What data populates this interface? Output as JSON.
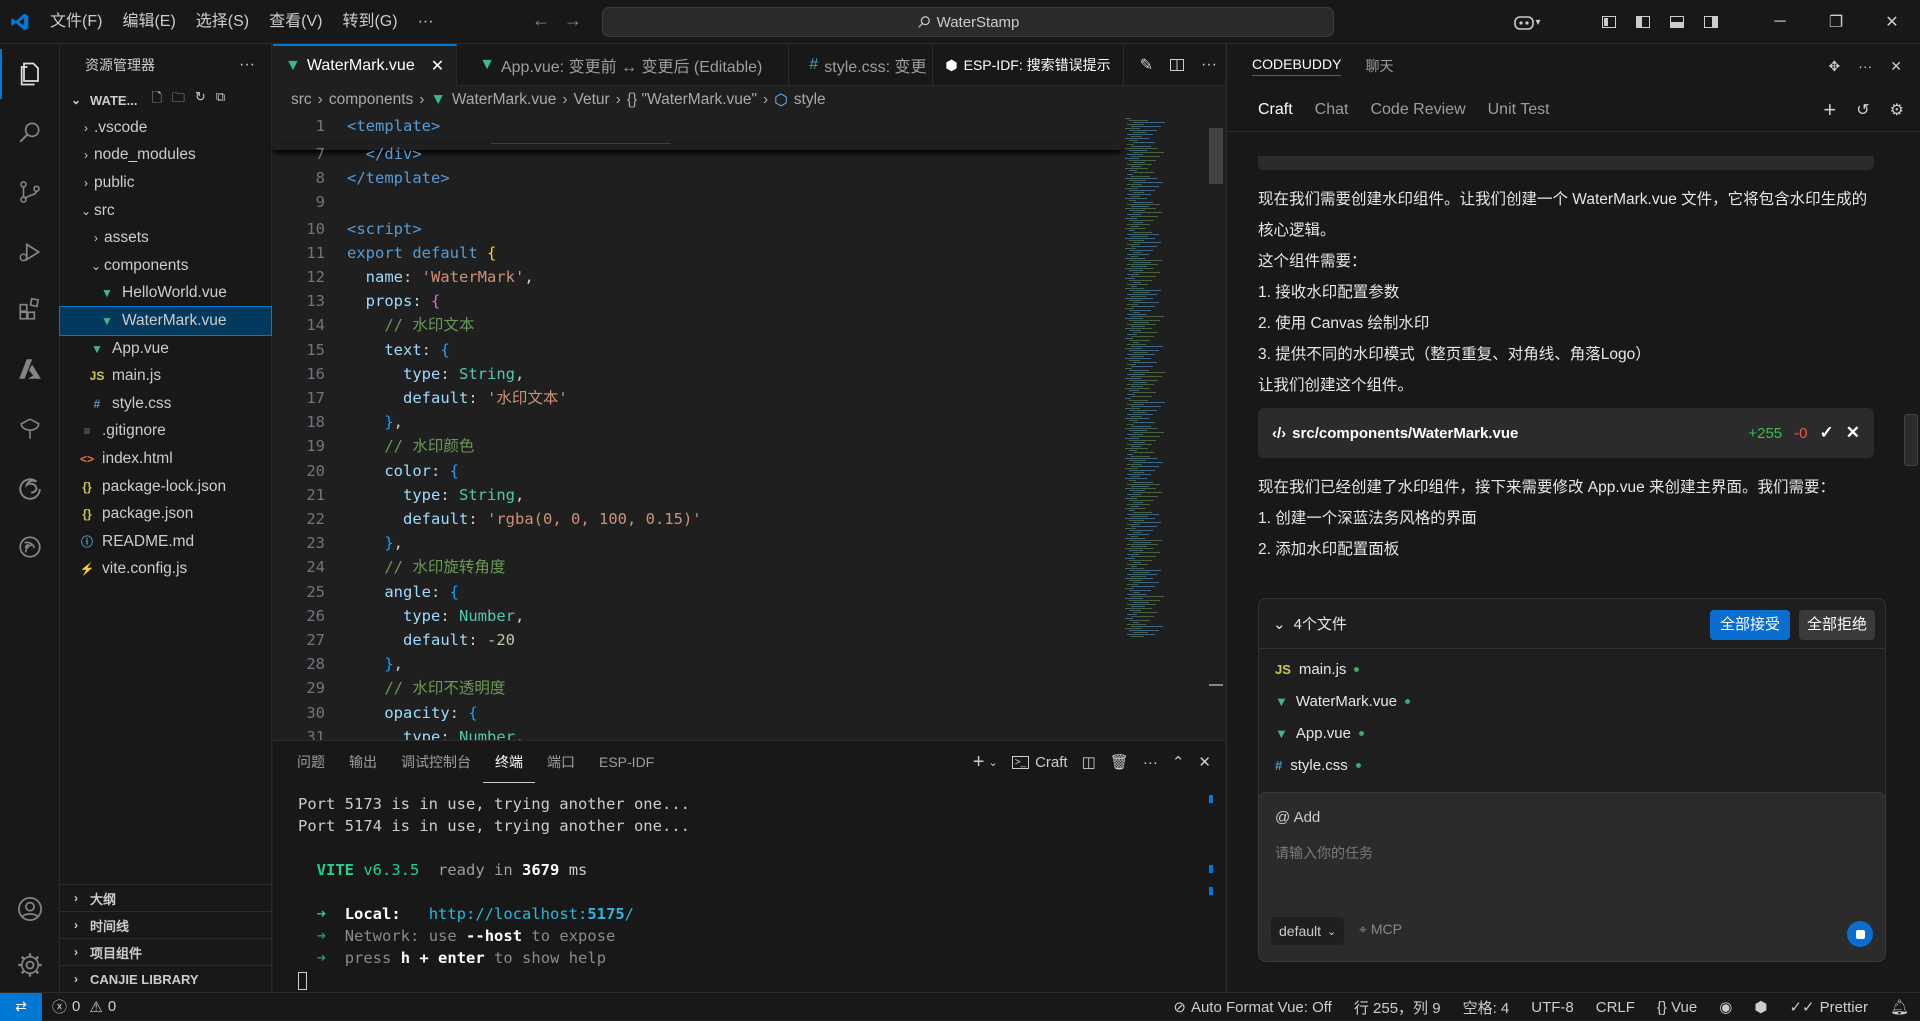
{
  "title_bar": {
    "menus": [
      "文件(F)",
      "编辑(E)",
      "选择(S)",
      "查看(V)",
      "转到(G)",
      "···"
    ],
    "search_text": "WaterStamp"
  },
  "explorer": {
    "title": "资源管理器",
    "folder": "WATE...",
    "items": [
      {
        "label": ".vscode",
        "kind": "folder",
        "indent": 1,
        "expanded": false
      },
      {
        "label": "node_modules",
        "kind": "folder",
        "indent": 1,
        "expanded": false
      },
      {
        "label": "public",
        "kind": "folder",
        "indent": 1,
        "expanded": false
      },
      {
        "label": "src",
        "kind": "folder",
        "indent": 1,
        "expanded": true
      },
      {
        "label": "assets",
        "kind": "folder",
        "indent": 2,
        "expanded": false
      },
      {
        "label": "components",
        "kind": "folder",
        "indent": 2,
        "expanded": true
      },
      {
        "label": "HelloWorld.vue",
        "kind": "vue",
        "indent": 3
      },
      {
        "label": "WaterMark.vue",
        "kind": "vue",
        "indent": 3,
        "active": true
      },
      {
        "label": "App.vue",
        "kind": "vue",
        "indent": 2
      },
      {
        "label": "main.js",
        "kind": "js",
        "indent": 2
      },
      {
        "label": "style.css",
        "kind": "css",
        "indent": 2
      },
      {
        "label": ".gitignore",
        "kind": "git",
        "indent": 1
      },
      {
        "label": "index.html",
        "kind": "html",
        "indent": 1
      },
      {
        "label": "package-lock.json",
        "kind": "json",
        "indent": 1
      },
      {
        "label": "package.json",
        "kind": "json",
        "indent": 1
      },
      {
        "label": "README.md",
        "kind": "info",
        "indent": 1
      },
      {
        "label": "vite.config.js",
        "kind": "vite",
        "indent": 1
      }
    ],
    "sections": [
      "大纲",
      "时间线",
      "项目组件",
      "CANJIE LIBRARY"
    ]
  },
  "editor": {
    "tabs": [
      {
        "label": "WaterMark.vue",
        "active": true
      },
      {
        "label": "App.vue: 变更前 ↔ 变更后 (Editable)",
        "active": false
      },
      {
        "label": "style.css: 变更",
        "active": false
      },
      {
        "label": "ESP-IDF:  搜索错误提示",
        "active": false
      }
    ],
    "breadcrumb": [
      "src",
      "components",
      "WaterMark.vue",
      "Vetur",
      "{} \"WaterMark.vue\"",
      "style"
    ],
    "code_lines": [
      {
        "n": "1",
        "tokens": [
          [
            "tag",
            "<template>"
          ]
        ]
      },
      {
        "n": "7",
        "tokens": [
          [
            "p",
            "  "
          ],
          [
            "tag",
            "</div>"
          ]
        ]
      },
      {
        "n": "8",
        "tokens": [
          [
            "tag",
            "</template>"
          ]
        ]
      },
      {
        "n": "9",
        "tokens": []
      },
      {
        "n": "10",
        "tokens": [
          [
            "tag",
            "<script>"
          ]
        ]
      },
      {
        "n": "11",
        "tokens": [
          [
            "kw",
            "export default "
          ],
          [
            "br",
            "{"
          ]
        ]
      },
      {
        "n": "12",
        "tokens": [
          [
            "p",
            "  "
          ],
          [
            "prop",
            "name"
          ],
          [
            "p",
            ": "
          ],
          [
            "str",
            "'WaterMark'"
          ],
          [
            "p",
            ","
          ]
        ]
      },
      {
        "n": "13",
        "tokens": [
          [
            "p",
            "  "
          ],
          [
            "prop",
            "props"
          ],
          [
            "p",
            ": "
          ],
          [
            "br2",
            "{"
          ]
        ]
      },
      {
        "n": "14",
        "tokens": [
          [
            "p",
            "    "
          ],
          [
            "com",
            "// 水印文本"
          ]
        ]
      },
      {
        "n": "15",
        "tokens": [
          [
            "p",
            "    "
          ],
          [
            "prop",
            "text"
          ],
          [
            "p",
            ": "
          ],
          [
            "br3",
            "{"
          ]
        ]
      },
      {
        "n": "16",
        "tokens": [
          [
            "p",
            "      "
          ],
          [
            "prop",
            "type"
          ],
          [
            "p",
            ": "
          ],
          [
            "typ",
            "String"
          ],
          [
            "p",
            ","
          ]
        ]
      },
      {
        "n": "17",
        "tokens": [
          [
            "p",
            "      "
          ],
          [
            "prop",
            "default"
          ],
          [
            "p",
            ": "
          ],
          [
            "str",
            "'水印文本'"
          ]
        ]
      },
      {
        "n": "18",
        "tokens": [
          [
            "p",
            "    "
          ],
          [
            "br3",
            "}"
          ],
          [
            "p",
            ","
          ]
        ]
      },
      {
        "n": "19",
        "tokens": [
          [
            "p",
            "    "
          ],
          [
            "com",
            "// 水印颜色"
          ]
        ]
      },
      {
        "n": "20",
        "tokens": [
          [
            "p",
            "    "
          ],
          [
            "prop",
            "color"
          ],
          [
            "p",
            ": "
          ],
          [
            "br3",
            "{"
          ]
        ]
      },
      {
        "n": "21",
        "tokens": [
          [
            "p",
            "      "
          ],
          [
            "prop",
            "type"
          ],
          [
            "p",
            ": "
          ],
          [
            "typ",
            "String"
          ],
          [
            "p",
            ","
          ]
        ]
      },
      {
        "n": "22",
        "tokens": [
          [
            "p",
            "      "
          ],
          [
            "prop",
            "default"
          ],
          [
            "p",
            ": "
          ],
          [
            "str",
            "'rgba(0, 0, 100, 0.15)'"
          ]
        ]
      },
      {
        "n": "23",
        "tokens": [
          [
            "p",
            "    "
          ],
          [
            "br3",
            "}"
          ],
          [
            "p",
            ","
          ]
        ]
      },
      {
        "n": "24",
        "tokens": [
          [
            "p",
            "    "
          ],
          [
            "com",
            "// 水印旋转角度"
          ]
        ]
      },
      {
        "n": "25",
        "tokens": [
          [
            "p",
            "    "
          ],
          [
            "prop",
            "angle"
          ],
          [
            "p",
            ": "
          ],
          [
            "br3",
            "{"
          ]
        ]
      },
      {
        "n": "26",
        "tokens": [
          [
            "p",
            "      "
          ],
          [
            "prop",
            "type"
          ],
          [
            "p",
            ": "
          ],
          [
            "typ",
            "Number"
          ],
          [
            "p",
            ","
          ]
        ]
      },
      {
        "n": "27",
        "tokens": [
          [
            "p",
            "      "
          ],
          [
            "prop",
            "default"
          ],
          [
            "p",
            ": "
          ],
          [
            "num",
            "-20"
          ]
        ]
      },
      {
        "n": "28",
        "tokens": [
          [
            "p",
            "    "
          ],
          [
            "br3",
            "}"
          ],
          [
            "p",
            ","
          ]
        ]
      },
      {
        "n": "29",
        "tokens": [
          [
            "p",
            "    "
          ],
          [
            "com",
            "// 水印不透明度"
          ]
        ]
      },
      {
        "n": "30",
        "tokens": [
          [
            "p",
            "    "
          ],
          [
            "prop",
            "opacity"
          ],
          [
            "p",
            ": "
          ],
          [
            "br3",
            "{"
          ]
        ]
      },
      {
        "n": "31",
        "tokens": [
          [
            "p",
            "      "
          ],
          [
            "prop",
            "type"
          ],
          [
            "p",
            ": "
          ],
          [
            "typ",
            "Number"
          ],
          [
            "p",
            ","
          ]
        ]
      }
    ]
  },
  "panel": {
    "tabs": [
      "问题",
      "输出",
      "调试控制台",
      "终端",
      "端口",
      "ESP-IDF"
    ],
    "active_tab": "终端",
    "terminal_label": "Craft",
    "terminal": {
      "line1": "Port 5173 is in use, trying another one...",
      "line2": "Port 5174 is in use, trying another one...",
      "vite": "VITE",
      "vite_version": "v6.3.5",
      "ready": "ready in",
      "ready_ms": "3679",
      "ms": "ms",
      "local_label": "Local:",
      "local_url": "http://localhost:",
      "local_port": "5175",
      "local_slash": "/",
      "network_label": "Network:",
      "network_text1": "use",
      "network_flag": "--host",
      "network_text2": "to expose",
      "help_text1": "press",
      "help_key": "h + enter",
      "help_text2": "to show help"
    }
  },
  "codebuddy": {
    "header_tabs": [
      "CODEBUDDY",
      "聊天"
    ],
    "tabs": [
      "Craft",
      "Chat",
      "Code Review",
      "Unit Test"
    ],
    "active_tab": "Craft",
    "messages": [
      "现在我们需要创建水印组件。让我们创建一个 WaterMark.vue 文件，它将包含水印生成的核心逻辑。",
      "这个组件需要：",
      "1. 接收水印配置参数",
      "2. 使用 Canvas 绘制水印",
      "3. 提供不同的水印模式（整页重复、对角线、角落Logo）",
      "让我们创建这个组件。"
    ],
    "file_card": {
      "path": "src/components/WaterMark.vue",
      "added": "+255",
      "removed": "-0"
    },
    "messages2": [
      "现在我们已经创建了水印组件，接下来需要修改 App.vue 来创建主界面。我们需要：",
      "1. 创建一个深蓝法务风格的界面",
      "2. 添加水印配置面板"
    ],
    "files_box": {
      "title": "4个文件",
      "accept_all": "全部接受",
      "reject_all": "全部拒绝",
      "files": [
        {
          "name": "main.js",
          "kind": "js"
        },
        {
          "name": "WaterMark.vue",
          "kind": "vue"
        },
        {
          "name": "App.vue",
          "kind": "vue"
        },
        {
          "name": "style.css",
          "kind": "css"
        }
      ]
    },
    "input": {
      "add_label": "Add",
      "placeholder": "请输入你的任务",
      "mode": "default",
      "mcp": "MCP"
    }
  },
  "status_bar": {
    "errors": "0",
    "warnings": "0",
    "items": [
      "Auto Format Vue: Off",
      "行 255，列 9",
      "空格: 4",
      "UTF-8",
      "CRLF",
      "{} Vue",
      "",
      "",
      "Prettier",
      ""
    ]
  },
  "colors": {
    "accent": "#0078d4",
    "vue_green": "#41b883",
    "js_yellow": "#cbcb41",
    "css_blue": "#519aba"
  }
}
